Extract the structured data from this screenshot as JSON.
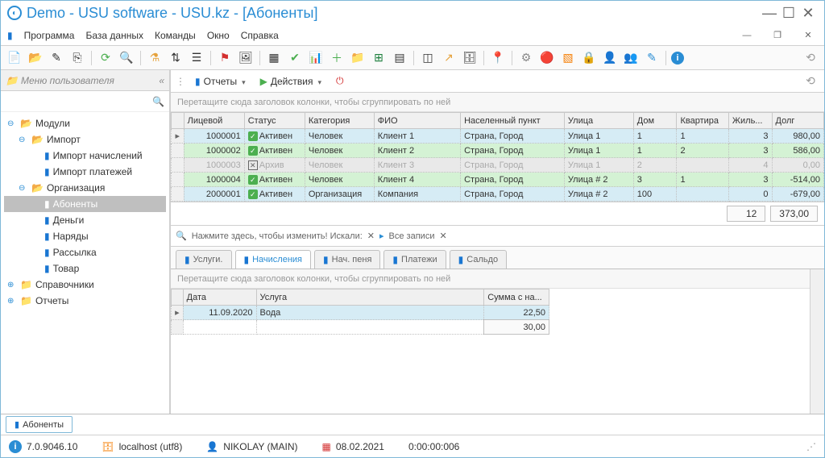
{
  "window": {
    "title": "Demo - USU software - USU.kz - [Абоненты]"
  },
  "menubar": {
    "items": [
      "Программа",
      "База данных",
      "Команды",
      "Окно",
      "Справка"
    ]
  },
  "sidebar": {
    "header": "Меню пользователя",
    "nodes": {
      "modules": "Модули",
      "import": "Импорт",
      "import_charges": "Импорт начислений",
      "import_payments": "Импорт платежей",
      "organization": "Организация",
      "subscribers": "Абоненты",
      "money": "Деньги",
      "orders": "Наряды",
      "mailing": "Рассылка",
      "goods": "Товар",
      "directories": "Справочники",
      "reports": "Отчеты"
    }
  },
  "main_toolbar": {
    "reports": "Отчеты",
    "actions": "Действия"
  },
  "group_hint": "Перетащите сюда заголовок колонки, чтобы сгруппировать по ней",
  "grid": {
    "columns": [
      "Лицевой",
      "Статус",
      "Категория",
      "ФИО",
      "Населенный пункт",
      "Улица",
      "Дом",
      "Квартира",
      "Жиль...",
      "Долг"
    ],
    "rows": [
      {
        "marker": "▸",
        "cls": "row-blue",
        "account": "1000001",
        "status_icon": "ok",
        "status": "Активен",
        "category": "Человек",
        "fio": "Клиент 1",
        "city": "Страна, Город",
        "street": "Улица 1",
        "house": "1",
        "flat": "1",
        "residents": "3",
        "debt": "980,00"
      },
      {
        "marker": "",
        "cls": "row-green",
        "account": "1000002",
        "status_icon": "ok",
        "status": "Активен",
        "category": "Человек",
        "fio": "Клиент 2",
        "city": "Страна, Город",
        "street": "Улица 1",
        "house": "1",
        "flat": "2",
        "residents": "3",
        "debt": "586,00"
      },
      {
        "marker": "",
        "cls": "row-archive",
        "account": "1000003",
        "status_icon": "x",
        "status": "Архив",
        "category": "Человек",
        "fio": "Клиент 3",
        "city": "Страна, Город",
        "street": "Улица 1",
        "house": "2",
        "flat": "",
        "residents": "4",
        "debt": "0,00"
      },
      {
        "marker": "",
        "cls": "row-green",
        "account": "1000004",
        "status_icon": "ok",
        "status": "Активен",
        "category": "Человек",
        "fio": "Клиент 4",
        "city": "Страна, Город",
        "street": "Улица # 2",
        "house": "3",
        "flat": "1",
        "residents": "3",
        "debt": "-514,00"
      },
      {
        "marker": "",
        "cls": "row-blue",
        "account": "2000001",
        "status_icon": "ok",
        "status": "Активен",
        "category": "Организация",
        "fio": "Компания",
        "city": "Страна, Город",
        "street": "Улица # 2",
        "house": "100",
        "flat": "",
        "residents": "0",
        "debt": "-679,00"
      }
    ],
    "summary": {
      "count": "12",
      "total": "373,00"
    }
  },
  "filter": {
    "hint": "Нажмите здесь, чтобы изменить! Искали:",
    "all": "Все записи"
  },
  "detail_tabs": [
    "Услуги.",
    "Начисления",
    "Нач. пеня",
    "Платежи",
    "Сальдо"
  ],
  "detail": {
    "columns": [
      "Дата",
      "Услуга",
      "Сумма с на..."
    ],
    "row": {
      "date": "11.09.2020",
      "service": "Вода",
      "sum": "22,50"
    },
    "total": "30,00"
  },
  "bottom_tab": "Абоненты",
  "status": {
    "version": "7.0.9046.10",
    "host": "localhost (utf8)",
    "user": "NIKOLAY (MAIN)",
    "date": "08.02.2021",
    "timer": "0:00:00:006"
  }
}
